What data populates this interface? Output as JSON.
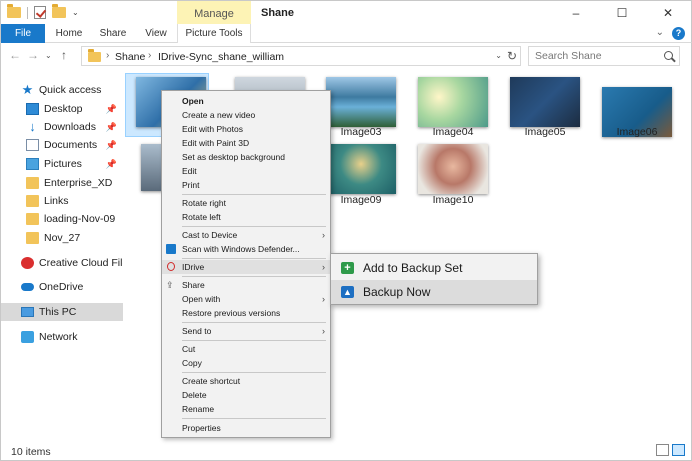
{
  "titlebar": {
    "manage_tab": "Manage",
    "title": "Shane",
    "minimize": "–",
    "maximize": "☐",
    "close": "✕"
  },
  "ribbon": {
    "file": "File",
    "home": "Home",
    "share": "Share",
    "view": "View",
    "picture_tools": "Picture Tools",
    "expand": "⌄",
    "help": "?"
  },
  "address": {
    "back": "←",
    "forward": "→",
    "recent": "⌄",
    "up": "↑",
    "sep1": "›",
    "crumb1": "Shane",
    "sep2": "›",
    "crumb2": "IDrive-Sync_shane_william",
    "dropdown": "⌄",
    "refresh": "↻",
    "search_placeholder": "Search Shane"
  },
  "nav": {
    "quick_access": "Quick access",
    "desktop": "Desktop",
    "downloads": "Downloads",
    "documents": "Documents",
    "pictures": "Pictures",
    "enterprise": "Enterprise_XD",
    "links": "Links",
    "loading": "loading-Nov-09",
    "nov27": "Nov_27",
    "creative_cloud": "Creative Cloud Files",
    "onedrive": "OneDrive",
    "this_pc": "This PC",
    "network": "Network",
    "pin": "📌"
  },
  "files": {
    "image03": "Image03",
    "image04": "Image04",
    "image05": "Image05",
    "image06": "Image06",
    "image09": "Image09",
    "image10": "Image10"
  },
  "status": {
    "count": "10 items"
  },
  "context_menu": {
    "open": "Open",
    "create_video": "Create a new video",
    "edit_photos": "Edit with Photos",
    "edit_paint3d": "Edit with Paint 3D",
    "set_background": "Set as desktop background",
    "edit": "Edit",
    "print": "Print",
    "rotate_right": "Rotate right",
    "rotate_left": "Rotate left",
    "cast": "Cast to Device",
    "scan": "Scan with Windows Defender...",
    "idrive": "IDrive",
    "share": "Share",
    "open_with": "Open with",
    "restore": "Restore previous versions",
    "send_to": "Send to",
    "cut": "Cut",
    "copy": "Copy",
    "create_shortcut": "Create shortcut",
    "delete": "Delete",
    "rename": "Rename",
    "properties": "Properties",
    "arrow": "›"
  },
  "submenu": {
    "add_backup_set": "Add to Backup Set",
    "backup_now": "Backup Now"
  },
  "colors": {
    "accent": "#1979ca",
    "manage_tab": "#fdf3b5",
    "selection": "#cce8ff"
  }
}
